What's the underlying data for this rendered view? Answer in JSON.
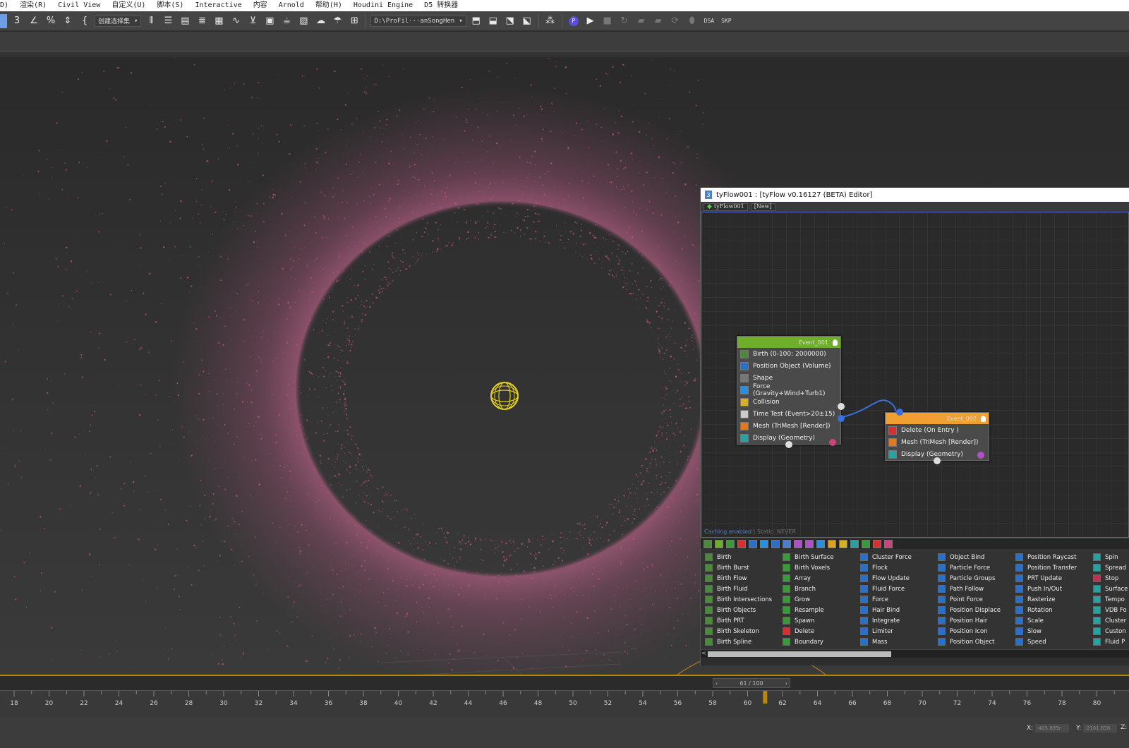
{
  "menu": [
    "D)",
    "渲染(R)",
    "Civil View",
    "自定义(U)",
    "脚本(S)",
    "Interactive",
    "内容",
    "Arnold",
    "帮助(H)",
    "Houdini Engine",
    "D5 转换器"
  ],
  "toolbar": {
    "selection_set": "创建选择集",
    "project_path": "D:\\ProFil···anSongHen",
    "text_buttons": [
      "DSA",
      "SKP"
    ]
  },
  "editor": {
    "title": "tyFlow001 : [tyFlow v0.16127 (BETA) Editor]",
    "tabs": [
      "tyFlow001",
      "[New]"
    ],
    "status_caching": "Caching enabled",
    "status_separator": " | ",
    "status_static": "Static: NEVER",
    "events": [
      {
        "name": "Event_001",
        "color": "#6fae2a",
        "operators": [
          {
            "label": "Birth (0-100: 2000000)",
            "icon": "birth-icon",
            "color": "#4a8a3a"
          },
          {
            "label": "Position Object (Volume)",
            "icon": "position-object-icon",
            "color": "#2a6fc8"
          },
          {
            "label": "Shape",
            "icon": "shape-icon",
            "color": "#777777"
          },
          {
            "label": "Force (Gravity+Wind+Turb1)",
            "icon": "force-icon",
            "color": "#2a8fe0"
          },
          {
            "label": "Collision",
            "icon": "collision-icon",
            "color": "#d8b020"
          },
          {
            "label": "Time Test (Event>20±15)",
            "icon": "time-test-icon",
            "color": "#cccccc"
          },
          {
            "label": "Mesh (TriMesh [Render])",
            "icon": "mesh-icon",
            "color": "#e07a20"
          },
          {
            "label": "Display (Geometry)",
            "icon": "display-icon",
            "color": "#2aa0a0"
          }
        ]
      },
      {
        "name": "Event_002",
        "color": "#f0a030",
        "operators": [
          {
            "label": "Delete (On Entry )",
            "icon": "delete-icon",
            "color": "#d83030"
          },
          {
            "label": "Mesh (TriMesh [Render])",
            "icon": "mesh-icon",
            "color": "#e07a20"
          },
          {
            "label": "Display (Geometry)",
            "icon": "display-icon",
            "color": "#2aa0a0"
          }
        ]
      }
    ],
    "operator_columns": [
      [
        "Birth",
        "Birth Burst",
        "Birth Flow",
        "Birth Fluid",
        "Birth Intersections",
        "Birth Objects",
        "Birth PRT",
        "Birth Skeleton",
        "Birth Spline"
      ],
      [
        "Birth Surface",
        "Birth Voxels",
        "Array",
        "Branch",
        "Grow",
        "Resample",
        "Spawn",
        "Delete",
        "Boundary"
      ],
      [
        "Cluster Force",
        "Flock",
        "Flow Update",
        "Fluid Force",
        "Force",
        "Hair Bind",
        "Integrate",
        "Limiter",
        "Mass"
      ],
      [
        "Object Bind",
        "Particle Force",
        "Particle Groups",
        "Path Follow",
        "Point Force",
        "Position Displace",
        "Position Hair",
        "Position Icon",
        "Position Object"
      ],
      [
        "Position Raycast",
        "Position Transfer",
        "PRT Update",
        "Push In/Out",
        "Rasterize",
        "Rotation",
        "Scale",
        "Slow",
        "Speed"
      ],
      [
        "Spin",
        "Spread",
        "Stop",
        "Surface",
        "Tempo",
        "VDB Fo",
        "Cluster",
        "Custon",
        "Fluid P"
      ]
    ]
  },
  "timeline": {
    "frame_display": "61 / 100",
    "current_frame": 61,
    "ticks": [
      18,
      20,
      22,
      24,
      26,
      28,
      30,
      32,
      34,
      36,
      38,
      40,
      42,
      44,
      46,
      48,
      50,
      52,
      54,
      56,
      58,
      60,
      62,
      64,
      66,
      68,
      70,
      72,
      74,
      76,
      78,
      80
    ]
  },
  "status": {
    "x_label": "X:",
    "x_value": "-405.699r",
    "y_label": "Y:",
    "y_value": "-2101.836",
    "z_label": "Z:"
  },
  "colors": {
    "particles": "#c2557f",
    "emitter": "#e6d21a",
    "wire": "#3a6fe0",
    "timeline_accent": "#b8860b"
  }
}
